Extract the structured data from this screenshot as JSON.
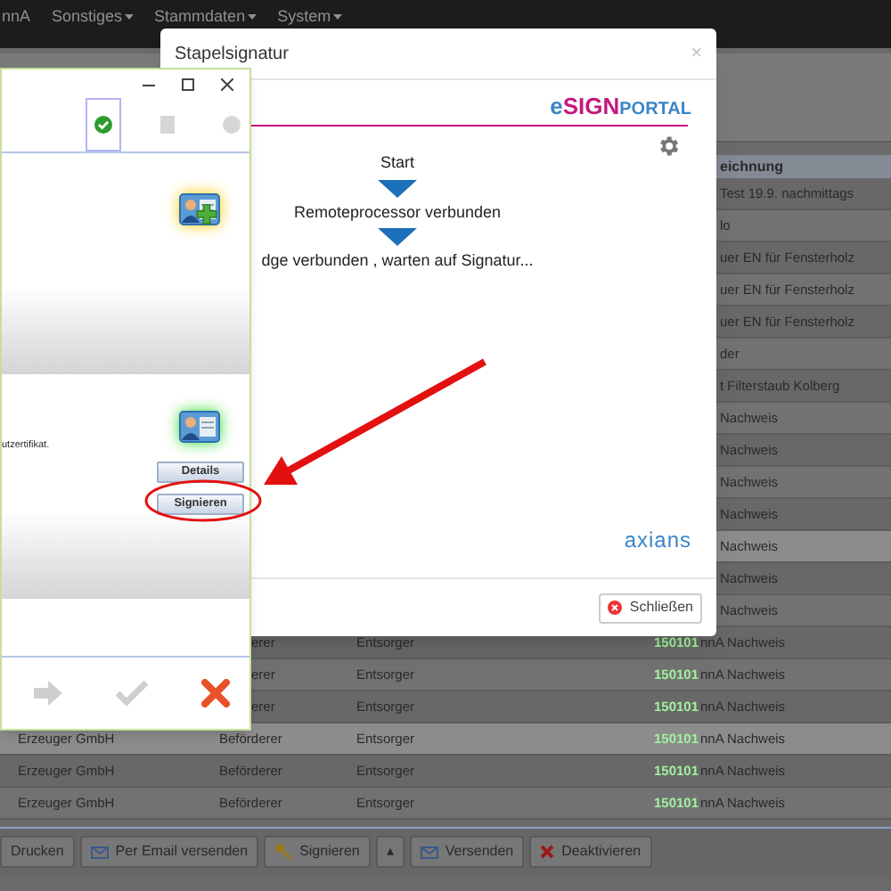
{
  "nav": {
    "items": [
      {
        "label": "nnA",
        "dropdown": false
      },
      {
        "label": "Sonstiges",
        "dropdown": true
      },
      {
        "label": "Stammdaten",
        "dropdown": true
      },
      {
        "label": "System",
        "dropdown": true
      }
    ]
  },
  "table": {
    "header": "eichnung",
    "rows": [
      {
        "kind": "right",
        "column_5": "Test 19.9. nachmittags",
        "selected": false
      },
      {
        "kind": "right",
        "column_5": "lo",
        "selected": false
      },
      {
        "kind": "right",
        "column_5": "uer EN für Fensterholz",
        "selected": false
      },
      {
        "kind": "right",
        "column_5": "uer EN für Fensterholz",
        "selected": false
      },
      {
        "kind": "right",
        "column_5": "uer EN für Fensterholz",
        "selected": false
      },
      {
        "kind": "right",
        "column_5": "der",
        "selected": false
      },
      {
        "kind": "right",
        "column_5": "t Filterstaub Kolberg",
        "selected": false
      },
      {
        "kind": "right",
        "column_5": "Nachweis",
        "selected": false
      },
      {
        "kind": "right",
        "column_5": "Nachweis",
        "selected": false
      },
      {
        "kind": "right",
        "column_5": "Nachweis",
        "selected": false
      },
      {
        "kind": "right",
        "column_5": "Nachweis",
        "selected": false
      },
      {
        "kind": "right",
        "column_5": "Nachweis",
        "selected": true
      },
      {
        "kind": "right",
        "column_5": "Nachweis",
        "selected": false
      },
      {
        "kind": "right",
        "column_5": "Nachweis",
        "selected": false
      },
      {
        "kind": "middle",
        "column_2": "erer",
        "column_3": "Entsorger",
        "column_4": "150101",
        "column_5": "nnA Nachweis",
        "selected": false
      },
      {
        "kind": "middle",
        "column_2": "erer",
        "column_3": "Entsorger",
        "column_4": "150101",
        "column_5": "nnA Nachweis",
        "selected": false
      },
      {
        "kind": "middle",
        "column_2": "erer",
        "column_3": "Entsorger",
        "column_4": "150101",
        "column_5": "nnA Nachweis",
        "selected": false
      },
      {
        "kind": "full",
        "column_1": "Erzeuger GmbH",
        "column_2": "Beförderer",
        "column_3": "Entsorger",
        "column_4": "150101",
        "column_5": "nnA Nachweis",
        "selected": true
      },
      {
        "kind": "full",
        "column_1": "Erzeuger GmbH",
        "column_2": "Beförderer",
        "column_3": "Entsorger",
        "column_4": "150101",
        "column_5": "nnA Nachweis",
        "selected": false
      },
      {
        "kind": "full",
        "column_1": "Erzeuger GmbH",
        "column_2": "Beförderer",
        "column_3": "Entsorger",
        "column_4": "150101",
        "column_5": "nnA Nachweis",
        "selected": false
      }
    ]
  },
  "toolbar": [
    {
      "kind": "print",
      "label": "Drucken"
    },
    {
      "kind": "mail",
      "label": "Per Email versenden"
    },
    {
      "kind": "key",
      "label": "Signieren"
    },
    {
      "kind": "caret",
      "label": "▴"
    },
    {
      "kind": "mail",
      "label": "Versenden"
    },
    {
      "kind": "delete",
      "label": "Deaktivieren"
    }
  ],
  "dialog": {
    "title": "Stapelsignatur",
    "close": "×",
    "logo": {
      "prefix": "e",
      "main": "SIGN",
      "suffix": "PORTAL"
    },
    "steps": [
      "Start",
      "Remoteprocessor verbunden",
      "dge verbunden , warten auf Signatur..."
    ],
    "footer_logo": "axians",
    "close_button": "Schließen"
  },
  "signer_window": {
    "tabs": [
      {
        "kind": "check",
        "selected": true
      },
      {
        "kind": "document",
        "selected": false
      },
      {
        "kind": "circle",
        "selected": false
      }
    ],
    "cert_text": "utzertifikat.",
    "buttons": [
      "Details",
      "Signieren"
    ],
    "actions": [
      {
        "kind": "next",
        "disabled": true
      },
      {
        "kind": "confirm",
        "disabled": true
      },
      {
        "kind": "cancel",
        "disabled": false
      }
    ]
  }
}
